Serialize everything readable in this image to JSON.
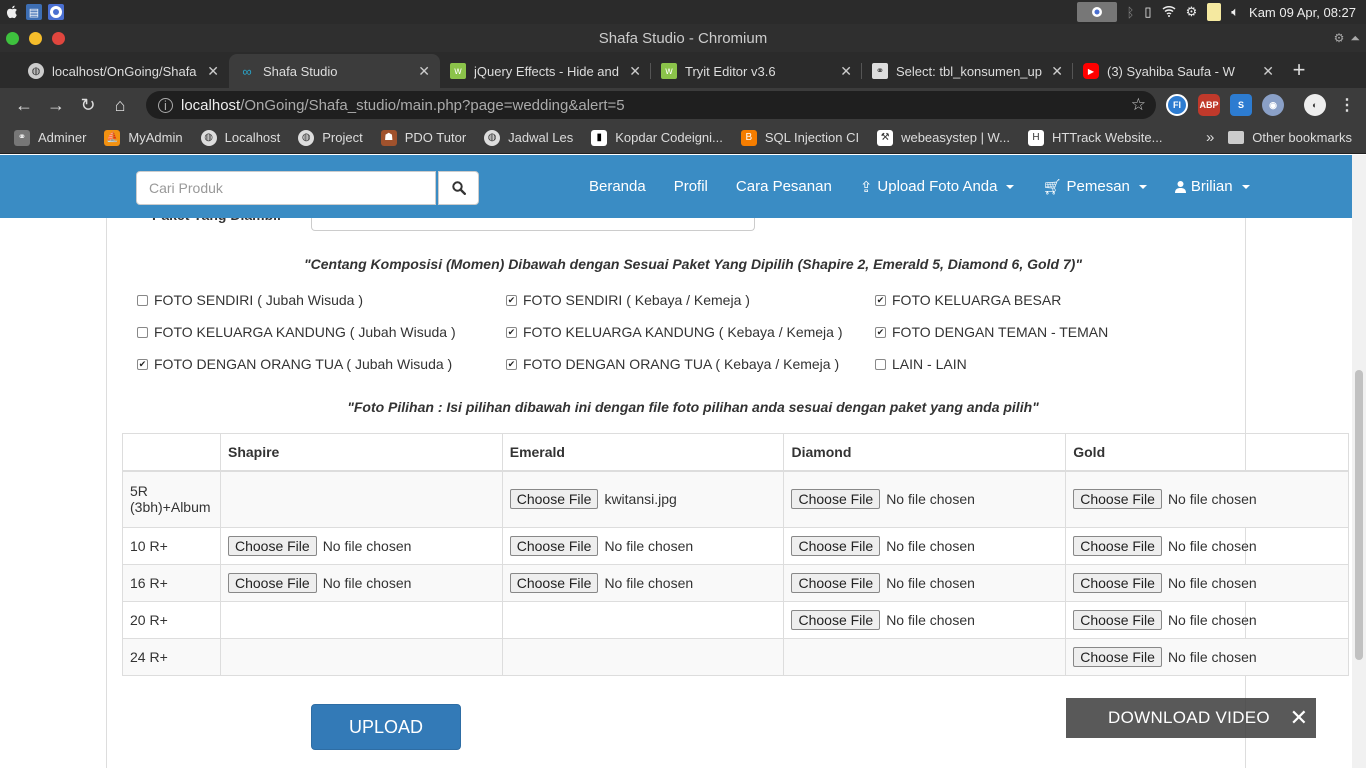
{
  "os": {
    "datetime": "Kam 09 Apr, 08:27"
  },
  "window": {
    "title": "Shafa Studio - Chromium"
  },
  "tabs": [
    {
      "label": "localhost/OnGoing/Shafa",
      "favicon_color": "#cccccc"
    },
    {
      "label": "Shafa Studio",
      "favicon_color": "#2aa4c9"
    },
    {
      "label": "jQuery Effects - Hide and",
      "favicon_color": "#8bc34a"
    },
    {
      "label": "Tryit Editor v3.6",
      "favicon_color": "#8bc34a"
    },
    {
      "label": "Select: tbl_konsumen_up",
      "favicon_color": "#dddddd"
    },
    {
      "label": "(3) Syahiba Saufa - W",
      "favicon_color": "#ff0000"
    }
  ],
  "address": {
    "host": "localhost",
    "path": "/OnGoing/Shafa_studio/main.php?page=wedding&alert=5"
  },
  "bookmarks": [
    {
      "label": "Adminer",
      "icon": "adminer-icon"
    },
    {
      "label": "MyAdmin",
      "icon": "phpmyadmin-icon"
    },
    {
      "label": "Localhost",
      "icon": "globe-icon"
    },
    {
      "label": "Project",
      "icon": "globe-icon"
    },
    {
      "label": "PDO Tutor",
      "icon": "pdo-icon"
    },
    {
      "label": "Jadwal Les",
      "icon": "globe-icon"
    },
    {
      "label": "Kopdar Codeigni...",
      "icon": "kopdar-icon"
    },
    {
      "label": "SQL Injection CI",
      "icon": "blogger-icon"
    },
    {
      "label": "webeasystep | W...",
      "icon": "webeasystep-icon"
    },
    {
      "label": "HTTrack Website...",
      "icon": "httrack-icon"
    }
  ],
  "bookmarks_other": "Other bookmarks",
  "site": {
    "search_placeholder": "Cari Produk",
    "menu": {
      "beranda": "Beranda",
      "profil": "Profil",
      "cara": "Cara Pesanan",
      "upload": "Upload Foto Anda",
      "pemesan": "Pemesan",
      "user": "Brilian"
    }
  },
  "form": {
    "paket_label": "Paket Yang Diambil",
    "instruction_1": "\"Centang Komposisi (Momen) Dibawah dengan Sesuai Paket Yang Dipilih (Shapire 2, Emerald 5, Diamond 6, Gold 7)\"",
    "checkboxes": [
      {
        "label": "FOTO SENDIRI ( Jubah Wisuda )",
        "checked": false
      },
      {
        "label": "FOTO SENDIRI ( Kebaya / Kemeja )",
        "checked": true
      },
      {
        "label": "FOTO KELUARGA BESAR",
        "checked": true
      },
      {
        "label": "FOTO KELUARGA KANDUNG ( Jubah Wisuda )",
        "checked": false
      },
      {
        "label": "FOTO KELUARGA KANDUNG ( Kebaya / Kemeja )",
        "checked": true
      },
      {
        "label": "FOTO DENGAN TEMAN - TEMAN",
        "checked": true
      },
      {
        "label": "FOTO DENGAN ORANG TUA ( Jubah Wisuda )",
        "checked": true
      },
      {
        "label": "FOTO DENGAN ORANG TUA ( Kebaya / Kemeja )",
        "checked": true
      },
      {
        "label": "LAIN - LAIN",
        "checked": false
      }
    ],
    "instruction_2": "\"Foto Pilihan : Isi pilihan dibawah ini dengan file foto pilihan anda sesuai dengan paket yang anda pilih\"",
    "table": {
      "headers": [
        "",
        "Shapire",
        "Emerald",
        "Diamond",
        "Gold"
      ],
      "choose_label": "Choose File",
      "rows": [
        {
          "size": "5R (3bh)+Album",
          "cells": [
            null,
            "kwitansi.jpg",
            "No file chosen",
            "No file chosen"
          ]
        },
        {
          "size": "10 R+",
          "cells": [
            "No file chosen",
            "No file chosen",
            "No file chosen",
            "No file chosen"
          ]
        },
        {
          "size": "16 R+",
          "cells": [
            "No file chosen",
            "No file chosen",
            "No file chosen",
            "No file chosen"
          ]
        },
        {
          "size": "20 R+",
          "cells": [
            null,
            null,
            "No file chosen",
            "No file chosen"
          ]
        },
        {
          "size": "24 R+",
          "cells": [
            null,
            null,
            null,
            "No file chosen"
          ]
        }
      ]
    },
    "upload_label": "UPLOAD"
  },
  "popup": {
    "label": "DOWNLOAD VIDEO"
  }
}
